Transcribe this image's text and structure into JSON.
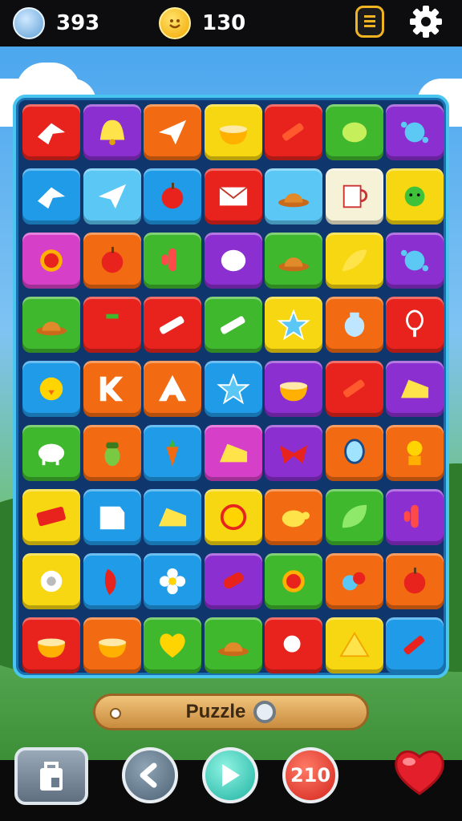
{
  "hud": {
    "coins_value": "393",
    "smiles_value": "130",
    "coin_icon": "globe-coin-icon",
    "smile_icon": "smiley-coin-icon",
    "clipboard_icon": "clipboard-icon",
    "settings_icon": "gear-icon"
  },
  "colors": {
    "board_border": "#49c6f0",
    "board_bg": "#10366e",
    "red": "#e8231d",
    "purple": "#8b2fd0",
    "orange": "#f26a12",
    "yellow": "#f7d711",
    "green": "#3fb82e",
    "blue": "#1f9be8",
    "pink": "#d640c9",
    "light_blue": "#5bc7f5",
    "cream": "#f6f2d7"
  },
  "board": {
    "rows": [
      [
        {
          "c": "red",
          "icon": "bird-icon"
        },
        {
          "c": "purple",
          "icon": "bell-icon"
        },
        {
          "c": "orange",
          "icon": "paper-plane-icon"
        },
        {
          "c": "yellow",
          "icon": "bowl-icon"
        },
        {
          "c": "red",
          "icon": "crayon-icon"
        },
        {
          "c": "green",
          "icon": "lemon-icon"
        },
        {
          "c": "purple",
          "icon": "splat-icon"
        }
      ],
      [
        {
          "c": "blue",
          "icon": "bird-icon"
        },
        {
          "c": "light_blue",
          "icon": "paper-plane-icon"
        },
        {
          "c": "blue",
          "icon": "apple-icon"
        },
        {
          "c": "red",
          "icon": "envelope-icon"
        },
        {
          "c": "light_blue",
          "icon": "hat-icon"
        },
        {
          "c": "cream",
          "icon": "jug-icon"
        },
        {
          "c": "yellow",
          "icon": "germ-icon"
        }
      ],
      [
        {
          "c": "pink",
          "icon": "sun-icon"
        },
        {
          "c": "orange",
          "icon": "apple-icon"
        },
        {
          "c": "green",
          "icon": "cactus-icon"
        },
        {
          "c": "purple",
          "icon": "balloon-icon"
        },
        {
          "c": "green",
          "icon": "hat-icon"
        },
        {
          "c": "yellow",
          "icon": "pepper-icon"
        },
        {
          "c": "purple",
          "icon": "splat-icon"
        }
      ],
      [
        {
          "c": "green",
          "icon": "hat-icon"
        },
        {
          "c": "red",
          "icon": "strawberry-icon"
        },
        {
          "c": "red",
          "icon": "pencil-icon"
        },
        {
          "c": "green",
          "icon": "pencil-icon"
        },
        {
          "c": "yellow",
          "icon": "star-icon"
        },
        {
          "c": "orange",
          "icon": "vase-icon"
        },
        {
          "c": "red",
          "icon": "whisk-icon"
        }
      ],
      [
        {
          "c": "blue",
          "icon": "chick-icon"
        },
        {
          "c": "orange",
          "icon": "letter-k-icon"
        },
        {
          "c": "orange",
          "icon": "letter-a-icon"
        },
        {
          "c": "blue",
          "icon": "star-icon"
        },
        {
          "c": "purple",
          "icon": "bowl-icon"
        },
        {
          "c": "red",
          "icon": "crayon-icon"
        },
        {
          "c": "purple",
          "icon": "cheese-icon"
        }
      ],
      [
        {
          "c": "green",
          "icon": "sheep-icon"
        },
        {
          "c": "orange",
          "icon": "acorn-icon"
        },
        {
          "c": "blue",
          "icon": "carrot-icon"
        },
        {
          "c": "pink",
          "icon": "cheese-icon"
        },
        {
          "c": "purple",
          "icon": "ribbon-icon"
        },
        {
          "c": "orange",
          "icon": "mirror-icon"
        },
        {
          "c": "orange",
          "icon": "flower-pot-icon"
        }
      ],
      [
        {
          "c": "yellow",
          "icon": "eraser-icon"
        },
        {
          "c": "blue",
          "icon": "paper-icon"
        },
        {
          "c": "blue",
          "icon": "cheese-icon"
        },
        {
          "c": "yellow",
          "icon": "badge-icon"
        },
        {
          "c": "orange",
          "icon": "turtle-icon"
        },
        {
          "c": "green",
          "icon": "leaf-icon"
        },
        {
          "c": "purple",
          "icon": "cactus-icon"
        }
      ],
      [
        {
          "c": "yellow",
          "icon": "gear-icon"
        },
        {
          "c": "blue",
          "icon": "feather-icon"
        },
        {
          "c": "blue",
          "icon": "flower-icon"
        },
        {
          "c": "purple",
          "icon": "candy-icon"
        },
        {
          "c": "green",
          "icon": "sun-icon"
        },
        {
          "c": "orange",
          "icon": "berries-icon"
        },
        {
          "c": "orange",
          "icon": "apple-icon"
        }
      ],
      [
        {
          "c": "red",
          "icon": "bowl-icon"
        },
        {
          "c": "orange",
          "icon": "bowl-icon"
        },
        {
          "c": "green",
          "icon": "heart-icon"
        },
        {
          "c": "green",
          "icon": "hat-icon"
        },
        {
          "c": "red",
          "icon": "magnifier-icon"
        },
        {
          "c": "yellow",
          "icon": "nacho-icon"
        },
        {
          "c": "blue",
          "icon": "marker-icon"
        }
      ]
    ]
  },
  "puzzle_bar": {
    "label": "Puzzle",
    "icon": "refresh-ring-icon"
  },
  "bottom_nav": {
    "bag_icon": "shopping-bag-icon",
    "back_icon": "back-arrow-icon",
    "play_icon": "play-icon",
    "count_value": "210",
    "heart_icon": "heart-icon"
  }
}
